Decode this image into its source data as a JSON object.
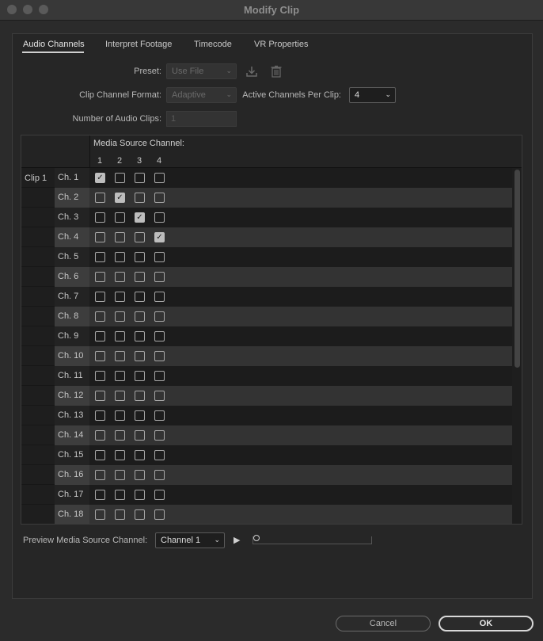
{
  "window": {
    "title": "Modify Clip"
  },
  "tabs": [
    {
      "label": "Audio Channels",
      "active": true
    },
    {
      "label": "Interpret Footage",
      "active": false
    },
    {
      "label": "Timecode",
      "active": false
    },
    {
      "label": "VR Properties",
      "active": false
    }
  ],
  "form": {
    "preset_label": "Preset:",
    "preset_value": "Use File",
    "clip_channel_format_label": "Clip Channel Format:",
    "clip_channel_format_value": "Adaptive",
    "active_channels_label": "Active Channels Per Clip:",
    "active_channels_value": "4",
    "num_audio_clips_label": "Number of Audio Clips:",
    "num_audio_clips_value": "1"
  },
  "grid": {
    "header_title": "Media Source Channel:",
    "source_channels": [
      "1",
      "2",
      "3",
      "4"
    ],
    "clip_label": "Clip 1",
    "rows": [
      {
        "label": "Ch. 1",
        "checked": [
          true,
          false,
          false,
          false
        ]
      },
      {
        "label": "Ch. 2",
        "checked": [
          false,
          true,
          false,
          false
        ]
      },
      {
        "label": "Ch. 3",
        "checked": [
          false,
          false,
          true,
          false
        ]
      },
      {
        "label": "Ch. 4",
        "checked": [
          false,
          false,
          false,
          true
        ]
      },
      {
        "label": "Ch. 5",
        "checked": [
          false,
          false,
          false,
          false
        ]
      },
      {
        "label": "Ch. 6",
        "checked": [
          false,
          false,
          false,
          false
        ]
      },
      {
        "label": "Ch. 7",
        "checked": [
          false,
          false,
          false,
          false
        ]
      },
      {
        "label": "Ch. 8",
        "checked": [
          false,
          false,
          false,
          false
        ]
      },
      {
        "label": "Ch. 9",
        "checked": [
          false,
          false,
          false,
          false
        ]
      },
      {
        "label": "Ch. 10",
        "checked": [
          false,
          false,
          false,
          false
        ]
      },
      {
        "label": "Ch. 11",
        "checked": [
          false,
          false,
          false,
          false
        ]
      },
      {
        "label": "Ch. 12",
        "checked": [
          false,
          false,
          false,
          false
        ]
      },
      {
        "label": "Ch. 13",
        "checked": [
          false,
          false,
          false,
          false
        ]
      },
      {
        "label": "Ch. 14",
        "checked": [
          false,
          false,
          false,
          false
        ]
      },
      {
        "label": "Ch. 15",
        "checked": [
          false,
          false,
          false,
          false
        ]
      },
      {
        "label": "Ch. 16",
        "checked": [
          false,
          false,
          false,
          false
        ]
      },
      {
        "label": "Ch. 17",
        "checked": [
          false,
          false,
          false,
          false
        ]
      },
      {
        "label": "Ch. 18",
        "checked": [
          false,
          false,
          false,
          false
        ]
      }
    ]
  },
  "preview": {
    "label": "Preview Media Source Channel:",
    "channel_value": "Channel 1",
    "position": 0
  },
  "buttons": {
    "cancel": "Cancel",
    "ok": "OK"
  },
  "icons": {
    "save_preset": "download-icon",
    "delete_preset": "trash-icon",
    "play": "play-icon",
    "checkmark": "✓"
  }
}
